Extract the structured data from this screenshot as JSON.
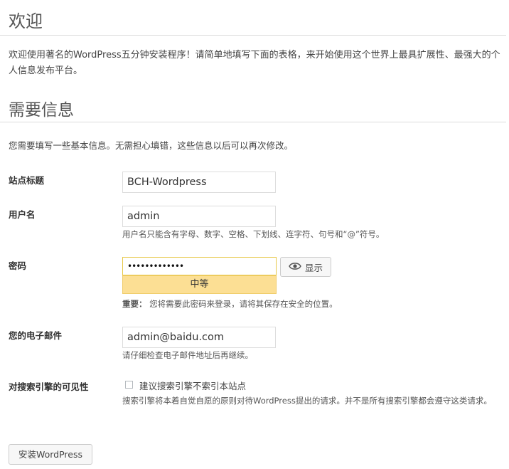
{
  "welcome": {
    "title": "欢迎",
    "text": "欢迎使用著名的WordPress五分钟安装程序！请简单地填写下面的表格，来开始使用这个世界上最具扩展性、最强大的个人信息发布平台。"
  },
  "required": {
    "title": "需要信息",
    "subtitle": "您需要填写一些基本信息。无需担心填错，这些信息以后可以再次修改。"
  },
  "form": {
    "site_title": {
      "label": "站点标题",
      "value": "BCH-Wordpress"
    },
    "username": {
      "label": "用户名",
      "value": "admin",
      "hint": "用户名只能含有字母、数字、空格、下划线、连字符、句号和“@”符号。"
    },
    "password": {
      "label": "密码",
      "value": "•••••••••••••",
      "strength": "中等",
      "show_label": "显示",
      "note_bold": "重要：",
      "note": "您将需要此密码来登录，请将其保存在安全的位置。"
    },
    "email": {
      "label": "您的电子邮件",
      "value": "admin@baidu.com",
      "hint": "请仔细检查电子邮件地址后再继续。"
    },
    "visibility": {
      "label": "对搜索引擎的可见性",
      "checkbox_label": "建议搜索引擎不索引本站点",
      "checked": false,
      "hint": "搜索引擎将本着自觉自愿的原则对待WordPress提出的请求。并不是所有搜索引擎都会遵守这类请求。"
    }
  },
  "submit_label": "安装WordPress",
  "icons": {
    "show": "eye-icon"
  }
}
